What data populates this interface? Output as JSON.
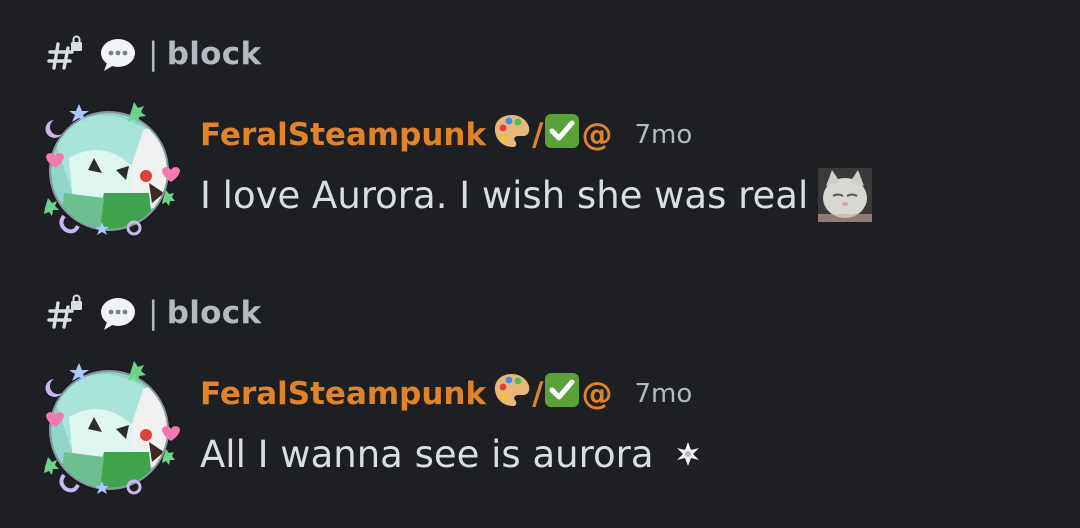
{
  "messages": [
    {
      "channel": {
        "separator": "|",
        "name": "block",
        "icons": [
          "locked-hash-icon",
          "speech-bubble-icon"
        ]
      },
      "author": {
        "name": "FeralSteampunk",
        "tag_slash": "/",
        "tag_at": "@",
        "tag_icons": [
          "palette-icon",
          "check-mark-icon"
        ],
        "color": "#e0832a"
      },
      "timestamp": "7mo",
      "content": "I love Aurora. I wish she was real",
      "trailing_emoji": "cat-face-emoji"
    },
    {
      "channel": {
        "separator": "|",
        "name": "block",
        "icons": [
          "locked-hash-icon",
          "speech-bubble-icon"
        ]
      },
      "author": {
        "name": "FeralSteampunk",
        "tag_slash": "/",
        "tag_at": "@",
        "tag_icons": [
          "palette-icon",
          "check-mark-icon"
        ],
        "color": "#e0832a"
      },
      "timestamp": "7mo",
      "content": "All I wanna see is aurora",
      "trailing_emoji": "sparkle-emoji"
    }
  ],
  "colors": {
    "background": "#1e1f22",
    "text": "#dbdee1",
    "muted": "#b5bac1",
    "username": "#e0832a",
    "check_green": "#5aa13a"
  }
}
